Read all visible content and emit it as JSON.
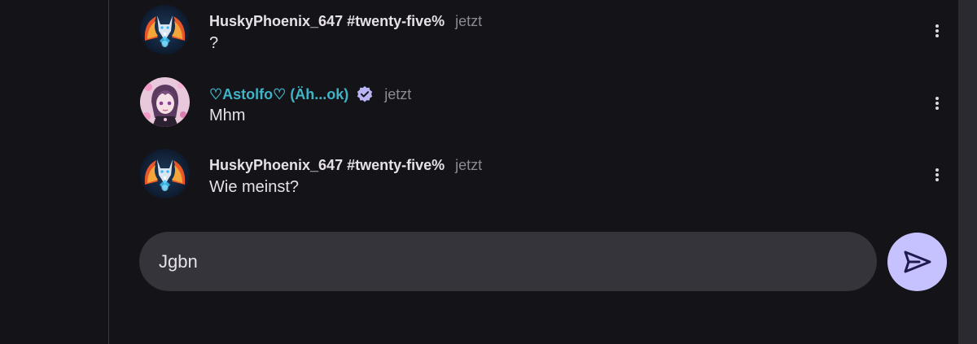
{
  "colors": {
    "background": "#141318",
    "author_accent": "#3fb4c8",
    "verified_badge": "#b9b4f4",
    "composer_bg": "#35343a",
    "send_button": "#c6c2ff"
  },
  "messages": [
    {
      "author": "HuskyPhoenix_647 #twenty-five%",
      "timestamp": "jetzt",
      "text": "?",
      "avatar_icon": "husky-phoenix-avatar",
      "menu_icon": "more-vert-icon"
    },
    {
      "author": "♡Astolfo♡ (Äh...ok)",
      "timestamp": "jetzt",
      "text": "Mhm",
      "avatar_icon": "astolfo-avatar",
      "verified_icon": "verified-badge-icon",
      "menu_icon": "more-vert-icon"
    },
    {
      "author": "HuskyPhoenix_647 #twenty-five%",
      "timestamp": "jetzt",
      "text": "Wie meinst?",
      "avatar_icon": "husky-phoenix-avatar",
      "menu_icon": "more-vert-icon"
    }
  ],
  "composer": {
    "value": "Jgbn",
    "send_icon": "send-icon"
  }
}
